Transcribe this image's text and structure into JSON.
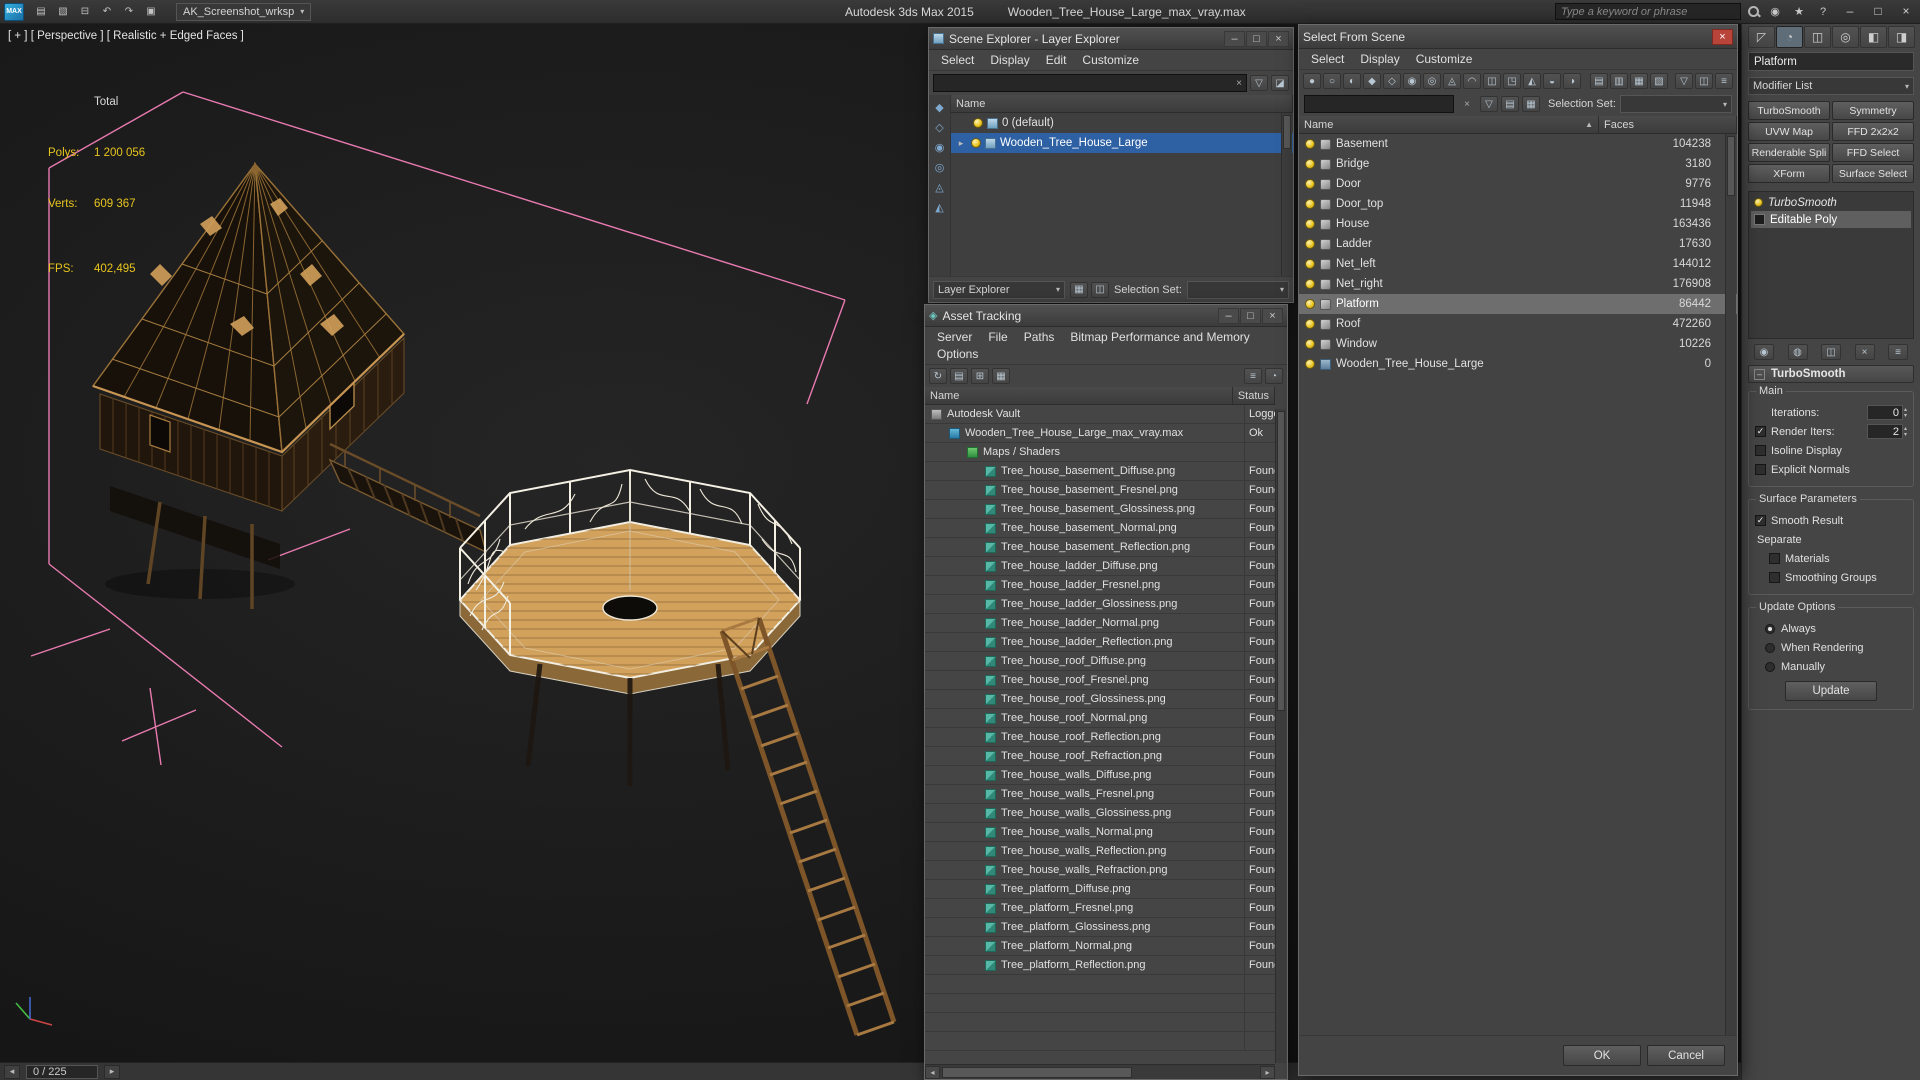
{
  "colors": {
    "selection_blue": "#2e61a3",
    "row_highlight_gray": "#6e6e6e",
    "stats_yellow": "#e8c51e",
    "close_red": "#b9443a",
    "wire_tan": "#c89552"
  },
  "glyphs": {
    "caret": "▾",
    "close": "×",
    "minimize": "–",
    "maximize": "□",
    "clear": "×",
    "sort_asc": "▲",
    "spin_up": "▴",
    "spin_down": "▾",
    "expander": "▸",
    "minus": "–",
    "left_arrow": "◂",
    "right_arrow": "▸",
    "check": "✓"
  },
  "titlebar": {
    "logo_text": "MAX",
    "workspace": "AK_Screenshot_wrksp",
    "app_title": "Autodesk 3ds Max  2015",
    "doc_title": "Wooden_Tree_House_Large_max_vray.max",
    "search_placeholder": "Type a keyword or phrase",
    "quick_access_icons": [
      {
        "name": "new-scene-icon",
        "glyph": "▤"
      },
      {
        "name": "open-file-icon",
        "glyph": "▧"
      },
      {
        "name": "save-file-icon",
        "glyph": "⊟"
      },
      {
        "name": "undo-icon",
        "glyph": "↶"
      },
      {
        "name": "redo-icon",
        "glyph": "↷"
      },
      {
        "name": "project-folder-icon",
        "glyph": "▣"
      }
    ],
    "infocenter_icons": [
      {
        "name": "communication-center-icon",
        "glyph": "◉"
      },
      {
        "name": "favorites-star-icon",
        "glyph": "★"
      },
      {
        "name": "help-icon",
        "glyph": "?"
      }
    ]
  },
  "viewport": {
    "label": "[ + ] [ Perspective ] [ Realistic + Edged Faces ]",
    "stats": {
      "total_label": "Total",
      "polys_label": "Polys:",
      "polys_value": "1 200 056",
      "verts_label": "Verts:",
      "verts_value": "609 367",
      "fps_label": "FPS:",
      "fps_value": "402,495"
    }
  },
  "status_bar": {
    "frame": "0 / 225"
  },
  "scene_explorer": {
    "title": "Scene Explorer - Layer Explorer",
    "menus": [
      "Select",
      "Display",
      "Edit",
      "Customize"
    ],
    "toolbar_icons": [
      {
        "name": "select-filter-icon",
        "glyph": "▽"
      },
      {
        "name": "pick-parent-icon",
        "glyph": "◪"
      }
    ],
    "strip_icons": [
      {
        "name": "filter-geometry-icon",
        "glyph": "◆"
      },
      {
        "name": "filter-shapes-icon",
        "glyph": "◇"
      },
      {
        "name": "filter-lights-icon",
        "glyph": "◉"
      },
      {
        "name": "filter-cameras-icon",
        "glyph": "◎"
      },
      {
        "name": "filter-helpers-icon",
        "glyph": "◬"
      },
      {
        "name": "filter-bones-icon",
        "glyph": "◭"
      }
    ],
    "name_header": "Name",
    "rows": [
      {
        "label": "0 (default)"
      },
      {
        "label": "Wooden_Tree_House_Large"
      }
    ],
    "footer": {
      "mode": "Layer Explorer",
      "selection_set_label": "Selection Set:",
      "icons": [
        {
          "name": "create-layer-icon",
          "glyph": "▦"
        },
        {
          "name": "add-selection-to-layer-icon",
          "glyph": "◫"
        }
      ]
    }
  },
  "asset_tracking": {
    "title": "Asset Tracking",
    "menus": [
      "Server",
      "File",
      "Paths",
      "Bitmap Performance and Memory",
      "Options"
    ],
    "toolbar_icons": [
      {
        "name": "refresh-status-icon",
        "glyph": "↻"
      },
      {
        "name": "details-view-icon",
        "glyph": "▤"
      },
      {
        "name": "table-view-icon",
        "glyph": "⊞"
      },
      {
        "name": "thumbnail-view-icon",
        "glyph": "▦"
      }
    ],
    "toolbar_right_icons": [
      {
        "name": "highlight-icon",
        "glyph": "≡"
      },
      {
        "name": "options-icon",
        "glyph": "◔"
      }
    ],
    "columns": [
      "Name",
      "Status"
    ],
    "rows": [
      {
        "name": "Autodesk Vault",
        "status": "Logged",
        "icon": "vault",
        "level": 0
      },
      {
        "name": "Wooden_Tree_House_Large_max_vray.max",
        "status": "Ok",
        "icon": "maxfile",
        "level": 1
      },
      {
        "name": "Maps / Shaders",
        "status": "",
        "icon": "shader",
        "level": 2
      },
      {
        "name": "Tree_house_basement_Diffuse.png",
        "status": "Found",
        "icon": "map",
        "level": 3
      },
      {
        "name": "Tree_house_basement_Fresnel.png",
        "status": "Found",
        "icon": "map",
        "level": 3
      },
      {
        "name": "Tree_house_basement_Glossiness.png",
        "status": "Found",
        "icon": "map",
        "level": 3
      },
      {
        "name": "Tree_house_basement_Normal.png",
        "status": "Found",
        "icon": "map",
        "level": 3
      },
      {
        "name": "Tree_house_basement_Reflection.png",
        "status": "Found",
        "icon": "map",
        "level": 3
      },
      {
        "name": "Tree_house_ladder_Diffuse.png",
        "status": "Found",
        "icon": "map",
        "level": 3
      },
      {
        "name": "Tree_house_ladder_Fresnel.png",
        "status": "Found",
        "icon": "map",
        "level": 3
      },
      {
        "name": "Tree_house_ladder_Glossiness.png",
        "status": "Found",
        "icon": "map",
        "level": 3
      },
      {
        "name": "Tree_house_ladder_Normal.png",
        "status": "Found",
        "icon": "map",
        "level": 3
      },
      {
        "name": "Tree_house_ladder_Reflection.png",
        "status": "Found",
        "icon": "map",
        "level": 3
      },
      {
        "name": "Tree_house_roof_Diffuse.png",
        "status": "Found",
        "icon": "map",
        "level": 3
      },
      {
        "name": "Tree_house_roof_Fresnel.png",
        "status": "Found",
        "icon": "map",
        "level": 3
      },
      {
        "name": "Tree_house_roof_Glossiness.png",
        "status": "Found",
        "icon": "map",
        "level": 3
      },
      {
        "name": "Tree_house_roof_Normal.png",
        "status": "Found",
        "icon": "map",
        "level": 3
      },
      {
        "name": "Tree_house_roof_Reflection.png",
        "status": "Found",
        "icon": "map",
        "level": 3
      },
      {
        "name": "Tree_house_roof_Refraction.png",
        "status": "Found",
        "icon": "map",
        "level": 3
      },
      {
        "name": "Tree_house_walls_Diffuse.png",
        "status": "Found",
        "icon": "map",
        "level": 3
      },
      {
        "name": "Tree_house_walls_Fresnel.png",
        "status": "Found",
        "icon": "map",
        "level": 3
      },
      {
        "name": "Tree_house_walls_Glossiness.png",
        "status": "Found",
        "icon": "map",
        "level": 3
      },
      {
        "name": "Tree_house_walls_Normal.png",
        "status": "Found",
        "icon": "map",
        "level": 3
      },
      {
        "name": "Tree_house_walls_Reflection.png",
        "status": "Found",
        "icon": "map",
        "level": 3
      },
      {
        "name": "Tree_house_walls_Refraction.png",
        "status": "Found",
        "icon": "map",
        "level": 3
      },
      {
        "name": "Tree_platform_Diffuse.png",
        "status": "Found",
        "icon": "map",
        "level": 3
      },
      {
        "name": "Tree_platform_Fresnel.png",
        "status": "Found",
        "icon": "map",
        "level": 3
      },
      {
        "name": "Tree_platform_Glossiness.png",
        "status": "Found",
        "icon": "map",
        "level": 3
      },
      {
        "name": "Tree_platform_Normal.png",
        "status": "Found",
        "icon": "map",
        "level": 3
      },
      {
        "name": "Tree_platform_Reflection.png",
        "status": "Found",
        "icon": "map",
        "level": 3
      }
    ]
  },
  "select_from_scene": {
    "title": "Select From Scene",
    "menus": [
      "Select",
      "Display",
      "Customize"
    ],
    "toolbar_icons": [
      {
        "name": "display-all-icon",
        "glyph": "●"
      },
      {
        "name": "display-none-icon",
        "glyph": "○"
      },
      {
        "name": "display-invert-icon",
        "glyph": "◐"
      },
      {
        "name": "filter-geometry-icon",
        "glyph": "◆"
      },
      {
        "name": "filter-shapes-icon",
        "glyph": "◇"
      },
      {
        "name": "filter-lights-icon",
        "glyph": "◉"
      },
      {
        "name": "filter-cameras-icon",
        "glyph": "◎"
      },
      {
        "name": "filter-helpers-icon",
        "glyph": "◬"
      },
      {
        "name": "filter-spacewarps-icon",
        "glyph": "◠"
      },
      {
        "name": "filter-groups-icon",
        "glyph": "◫"
      },
      {
        "name": "filter-xrefs-icon",
        "glyph": "◳"
      },
      {
        "name": "filter-bones-icon",
        "glyph": "◭"
      },
      {
        "name": "filter-frozen-icon",
        "glyph": "◒"
      },
      {
        "name": "filter-hidden-icon",
        "glyph": "◑"
      }
    ],
    "view_icons": [
      {
        "name": "view-list-icon",
        "glyph": "▤"
      },
      {
        "name": "view-columns-icon",
        "glyph": "▥"
      },
      {
        "name": "view-tree-icon",
        "glyph": "▦"
      },
      {
        "name": "view-detail-icon",
        "glyph": "▧"
      }
    ],
    "right_icons": [
      {
        "name": "filter-combinations-icon",
        "glyph": "▽"
      },
      {
        "name": "configure-columns-icon",
        "glyph": "◫"
      },
      {
        "name": "sync-selection-icon",
        "glyph": "≡"
      }
    ],
    "search_icons": [
      {
        "name": "find-options-icon",
        "glyph": "▽"
      },
      {
        "name": "layers-icon",
        "glyph": "▤"
      },
      {
        "name": "grid-columns-icon",
        "glyph": "▦"
      }
    ],
    "selection_set_label": "Selection Set:",
    "columns": [
      "Name",
      "Faces"
    ],
    "rows": [
      {
        "name": "Basement",
        "faces": "104238",
        "icon": "geom"
      },
      {
        "name": "Bridge",
        "faces": "3180",
        "icon": "geom"
      },
      {
        "name": "Door",
        "faces": "9776",
        "icon": "geom"
      },
      {
        "name": "Door_top",
        "faces": "11948",
        "icon": "geom"
      },
      {
        "name": "House",
        "faces": "163436",
        "icon": "geom"
      },
      {
        "name": "Ladder",
        "faces": "17630",
        "icon": "geom"
      },
      {
        "name": "Net_left",
        "faces": "144012",
        "icon": "geom"
      },
      {
        "name": "Net_right",
        "faces": "176908",
        "icon": "geom"
      },
      {
        "name": "Platform",
        "faces": "86442",
        "icon": "geom",
        "selected": true
      },
      {
        "name": "Roof",
        "faces": "472260",
        "icon": "geom"
      },
      {
        "name": "Window",
        "faces": "10226",
        "icon": "geom"
      },
      {
        "name": "Wooden_Tree_House_Large",
        "faces": "0",
        "icon": "root"
      }
    ],
    "ok_label": "OK",
    "cancel_label": "Cancel"
  },
  "command_panel": {
    "tabs": [
      {
        "name": "create-tab",
        "glyph": "◸"
      },
      {
        "name": "modify-tab",
        "glyph": "◔",
        "active": true
      },
      {
        "name": "hierarchy-tab",
        "glyph": "◫"
      },
      {
        "name": "motion-tab",
        "glyph": "◎"
      },
      {
        "name": "display-tab",
        "glyph": "◧"
      },
      {
        "name": "utilities-tab",
        "glyph": "◨"
      }
    ],
    "object_name": "Platform",
    "modifier_list_label": "Modifier List",
    "modifier_buttons": [
      "TurboSmooth",
      "Symmetry",
      "UVW Map",
      "FFD 2x2x2",
      "Renderable Spli",
      "FFD Select",
      "XForm",
      "Surface Select"
    ],
    "stack": [
      {
        "label": "TurboSmooth"
      },
      {
        "label": "Editable Poly",
        "selected": true
      }
    ],
    "stack_tool_icons": [
      {
        "name": "pin-stack-icon",
        "glyph": "◉"
      },
      {
        "name": "show-end-result-icon",
        "glyph": "◍"
      },
      {
        "name": "make-unique-icon",
        "glyph": "◫"
      },
      {
        "name": "remove-modifier-icon",
        "glyph": "×"
      },
      {
        "name": "configure-modifier-sets-icon",
        "glyph": "≡"
      }
    ],
    "rollout_title": "TurboSmooth",
    "groups": {
      "main": {
        "title": "Main",
        "iterations_label": "Iterations:",
        "iterations_value": "0",
        "render_iters_label": "Render Iters:",
        "render_iters_value": "2",
        "isoline_label": "Isoline Display",
        "explicit_label": "Explicit Normals"
      },
      "surface": {
        "title": "Surface Parameters",
        "smooth_result_label": "Smooth Result",
        "separate_label": "Separate",
        "materials_label": "Materials",
        "smoothing_label": "Smoothing Groups"
      },
      "update": {
        "title": "Update Options",
        "always_label": "Always",
        "when_label": "When Rendering",
        "manually_label": "Manually",
        "update_button": "Update"
      }
    }
  }
}
